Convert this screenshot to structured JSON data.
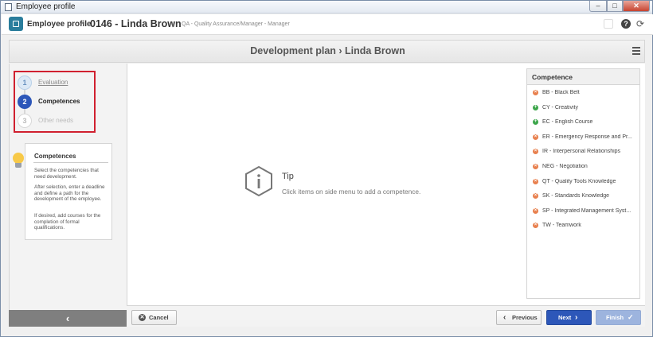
{
  "window": {
    "title": "Employee profile",
    "minimize_glyph": "–",
    "maximize_glyph": "□",
    "close_glyph": "✕"
  },
  "header": {
    "title": "Employee profile",
    "separator": "›",
    "record": "0146 - Linda Brown",
    "pipe": "|",
    "subtitle": "QA - Quality Assurance/Manager - Manager",
    "icons": [
      "app-logo-icon",
      "help-icon",
      "refresh-icon"
    ]
  },
  "plan": {
    "title": "Development plan › Linda Brown"
  },
  "steps": [
    {
      "number": "1",
      "label": "Evaluation",
      "state": "done"
    },
    {
      "number": "2",
      "label": "Competences",
      "state": "active"
    },
    {
      "number": "3",
      "label": "Other needs",
      "state": "disabled"
    }
  ],
  "help": {
    "title": "Competences",
    "p1": "Select the competencies that need development.",
    "p2": "After selection, enter a deadline and define a path for the development of the employee.",
    "p3": "If desired, add courses for the completion of formal qualifications."
  },
  "collapse": {
    "glyph": "‹"
  },
  "tip": {
    "title": "Tip",
    "text": "Click items on side menu to add a competence."
  },
  "competence": {
    "header": "Competence",
    "items": [
      {
        "label": "BB - Black Belt",
        "status": "remove"
      },
      {
        "label": "CY - Creativity",
        "status": "add"
      },
      {
        "label": "EC - English Course",
        "status": "add"
      },
      {
        "label": "ER - Emergency Response and Pr...",
        "status": "remove"
      },
      {
        "label": "IR - Interpersonal Relationships",
        "status": "remove"
      },
      {
        "label": "NEG - Negotiation",
        "status": "remove"
      },
      {
        "label": "QT - Quality Tools Knowledge",
        "status": "remove"
      },
      {
        "label": "SK - Standards Knowledge",
        "status": "remove"
      },
      {
        "label": "SP - Integrated Management Syst...",
        "status": "remove"
      },
      {
        "label": "TW - Teamwork",
        "status": "remove"
      }
    ]
  },
  "footer": {
    "cancel": "Cancel",
    "previous": "Previous",
    "next": "Next",
    "finish": "Finish",
    "prev_glyph": "‹",
    "next_glyph": "›",
    "finish_glyph": "✓",
    "cancel_glyph": "✕"
  },
  "colors": {
    "accent": "#2d57b9",
    "highlight_border": "#d0202f",
    "remove_dot": "#e8804e",
    "add_dot": "#3da64b"
  }
}
